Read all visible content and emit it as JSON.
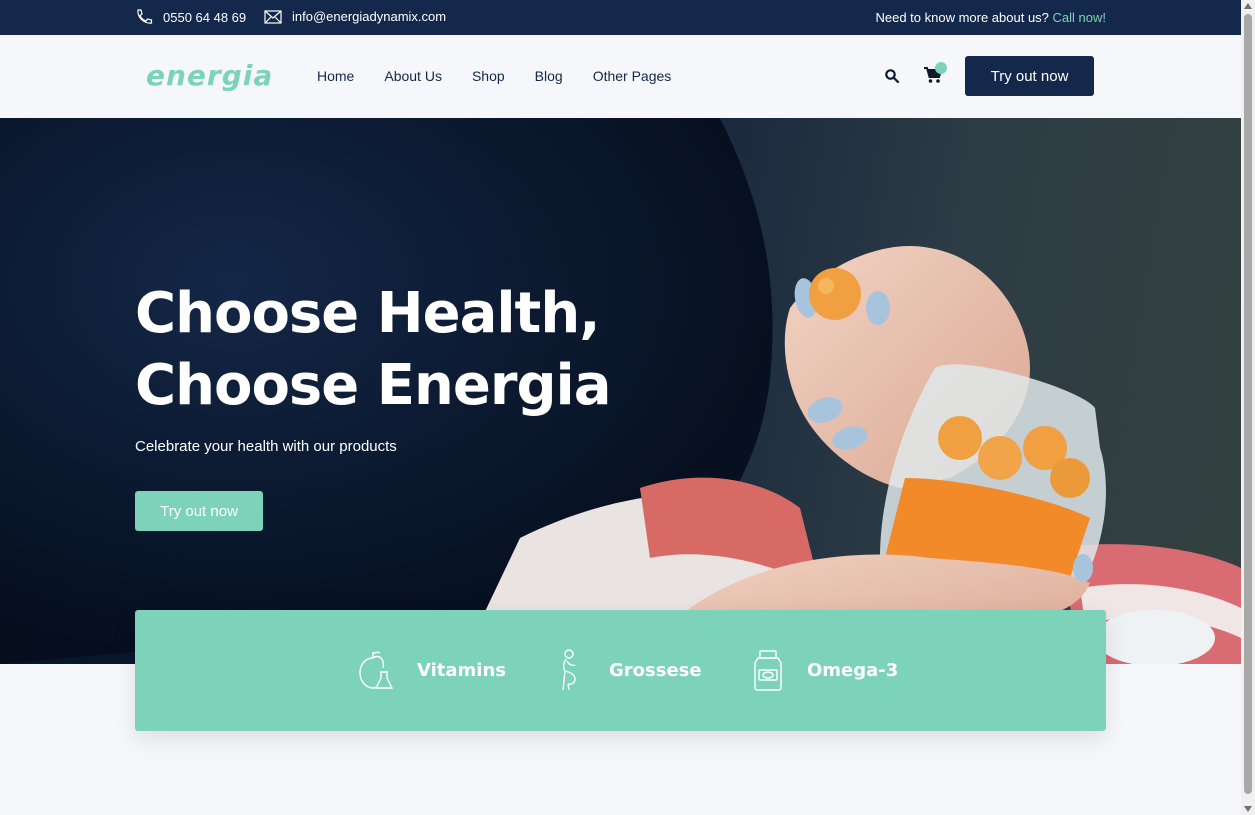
{
  "topbar": {
    "phone": "0550 64 48 69",
    "email": "info@energiadynamix.com",
    "ask_text": "Need to know more about us?",
    "ask_link": "Call now!"
  },
  "header": {
    "logo": "energia",
    "nav": [
      "Home",
      "About Us",
      "Shop",
      "Blog",
      "Other Pages"
    ],
    "cta": "Try out now"
  },
  "hero": {
    "title_line1": "Choose Health,",
    "title_line2": "Choose Energia",
    "subtitle": "Celebrate your health with our products",
    "cta": "Try out now"
  },
  "features": [
    {
      "label": "Vitamins",
      "icon": "vitamins-icon"
    },
    {
      "label": "Grossese",
      "icon": "pregnancy-icon"
    },
    {
      "label": "Omega-3",
      "icon": "supplement-bottle-icon"
    }
  ],
  "colors": {
    "navy": "#13284a",
    "mint": "#7dd3b9",
    "background": "#f6f7fb"
  }
}
